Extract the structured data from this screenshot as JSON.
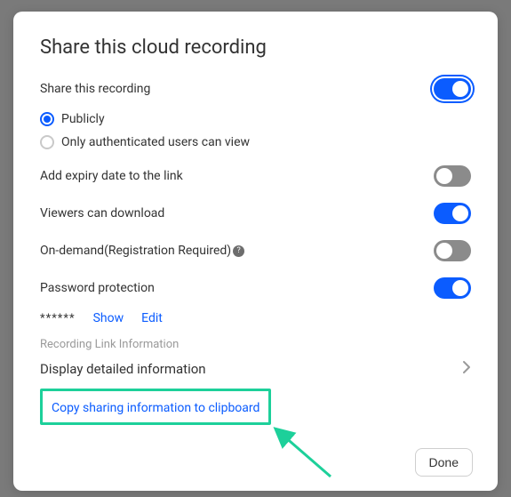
{
  "title": "Share this cloud recording",
  "share_recording": {
    "label": "Share this recording",
    "enabled": true,
    "options": {
      "public": "Publicly",
      "auth": "Only authenticated users can view",
      "selected": "public"
    }
  },
  "expiry": {
    "label": "Add expiry date to the link",
    "enabled": false
  },
  "download": {
    "label": "Viewers can download",
    "enabled": true
  },
  "ondemand": {
    "label": "On-demand(Registration Required)",
    "enabled": false
  },
  "password": {
    "label": "Password protection",
    "enabled": true,
    "mask": "******",
    "show_label": "Show",
    "edit_label": "Edit"
  },
  "link_info_header": "Recording Link Information",
  "display_detailed": "Display detailed information",
  "copy_link": "Copy sharing information to clipboard",
  "done": "Done",
  "colors": {
    "accent": "#0b5cff",
    "highlight": "#1dd09a"
  }
}
